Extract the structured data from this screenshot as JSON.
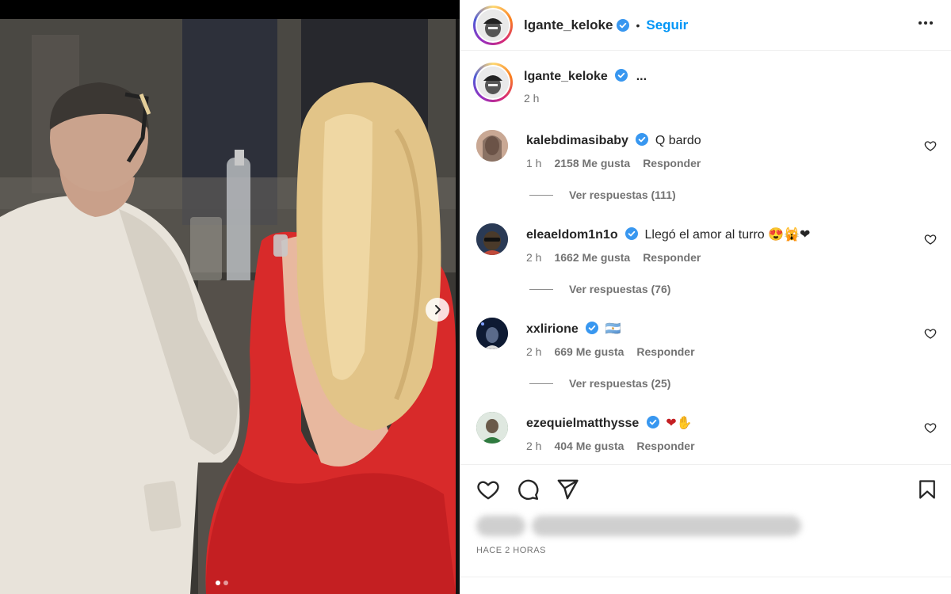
{
  "post": {
    "author": "lgante_keloke",
    "follow_label": "Seguir",
    "dot": "•",
    "ellipsis": "...",
    "caption_time": "2 h",
    "more_icon": "more-horizontal-icon",
    "verified_icon": "verified-badge-icon"
  },
  "comments": [
    {
      "user": "kalebdimasibaby",
      "text": "Q bardo",
      "time": "1 h",
      "likes": "2158 Me gusta",
      "reply_label": "Responder",
      "replies": "Ver respuestas (111)",
      "avatar_color": "#b98f7a"
    },
    {
      "user": "eleaeldom1n1o",
      "text": "Llegó el amor al turro 😍🙀❤",
      "time": "2 h",
      "likes": "1662 Me gusta",
      "reply_label": "Responder",
      "replies": "Ver respuestas (76)",
      "avatar_color": "#2a3a55"
    },
    {
      "user": "xxlirione",
      "text": "🇦🇷",
      "time": "2 h",
      "likes": "669 Me gusta",
      "reply_label": "Responder",
      "replies": "Ver respuestas (25)",
      "avatar_color": "#0e1a33"
    },
    {
      "user": "ezequielmatthysse",
      "text": "❤✋",
      "time": "2 h",
      "likes": "404 Me gusta",
      "reply_label": "Responder",
      "avatar_color": "#3f6e4a"
    }
  ],
  "actions": {
    "like_icon": "heart-icon",
    "comment_icon": "comment-icon",
    "share_icon": "send-icon",
    "save_icon": "bookmark-icon"
  },
  "timestamp": "HACE 2 HORAS",
  "colors": {
    "follow": "#0095f6",
    "verified": "#3897f0",
    "dress_red": "#d82a2a"
  }
}
